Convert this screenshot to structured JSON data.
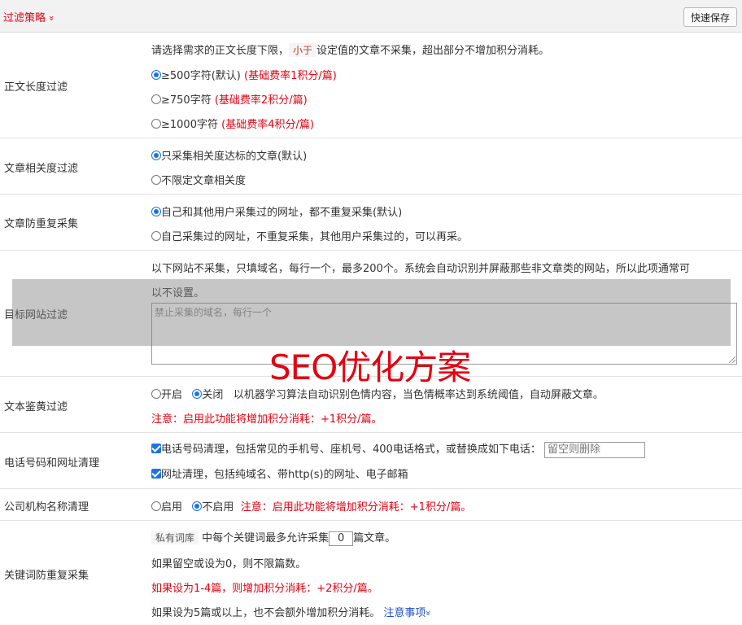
{
  "header": {
    "title": "过滤策略",
    "chevron": "»",
    "save_label": "快速保存"
  },
  "body_length": {
    "label": "正文长度过滤",
    "desc_pre": "请选择需求的正文长度下限，",
    "desc_tag": "小于",
    "desc_post": "设定值的文章不采集，超出部分不增加积分消耗。",
    "options": [
      {
        "text": "≥500字符(默认)",
        "note": "(基础费率1积分/篇)",
        "checked": true
      },
      {
        "text": "≥750字符",
        "note": "(基础费率2积分/篇)",
        "checked": false
      },
      {
        "text": "≥1000字符",
        "note": "(基础费率4积分/篇)",
        "checked": false
      }
    ]
  },
  "relevance": {
    "label": "文章相关度过滤",
    "options": [
      {
        "text": "只采集相关度达标的文章(默认)",
        "checked": true
      },
      {
        "text": "不限定文章相关度",
        "checked": false
      }
    ]
  },
  "dedupe": {
    "label": "文章防重复采集",
    "options": [
      {
        "text": "自己和其他用户采集过的网址，都不重复采集(默认)",
        "checked": true
      },
      {
        "text": "自己采集过的网址，不重复采集，其他用户采集过的，可以再采。",
        "checked": false
      }
    ]
  },
  "site_filter": {
    "label": "目标网站过滤",
    "desc_line1": "以下网站不采集，只填域名，每行一个，最多200个。系统会自动识别并屏蔽那些非文章类的网站，所以此项通常可",
    "desc_line2": "以不设置。",
    "placeholder": "禁止采集的域名，每行一个"
  },
  "watermark": "SEO优化方案",
  "porn_filter": {
    "label": "文本鉴黄过滤",
    "opt_on": "开启",
    "opt_off": "关闭",
    "desc": "以机器学习算法自动识别色情内容，当色情概率达到系统阈值，自动屏蔽文章。",
    "notice": "注意：启用此功能将增加积分消耗：+1积分/篇。"
  },
  "phone_url": {
    "label": "电话号码和网址清理",
    "phone_text": "电话号码清理，包括常见的手机号、座机号、400电话格式，或替换成如下电话：",
    "phone_placeholder": "留空则删除",
    "url_text": "网址清理，包括纯域名、带http(s)的网址、电子邮箱"
  },
  "org_name": {
    "label": "公司机构名称清理",
    "opt_on": "启用",
    "opt_off": "不启用",
    "notice": "注意：启用此功能将增加积分消耗：+1积分/篇。"
  },
  "keyword": {
    "label": "关键词防重复采集",
    "tag": "私有词库",
    "line1_pre": "中每个关键词最多允许采集",
    "value": "0",
    "line1_post": "篇文章。",
    "line2": "如果留空或设为0，则不限篇数。",
    "line3": "如果设为1-4篇，则增加积分消耗：+2积分/篇。",
    "line4": "如果设为5篇或以上，也不会额外增加积分消耗。",
    "link": "注意事项",
    "link_chevron": "»"
  }
}
